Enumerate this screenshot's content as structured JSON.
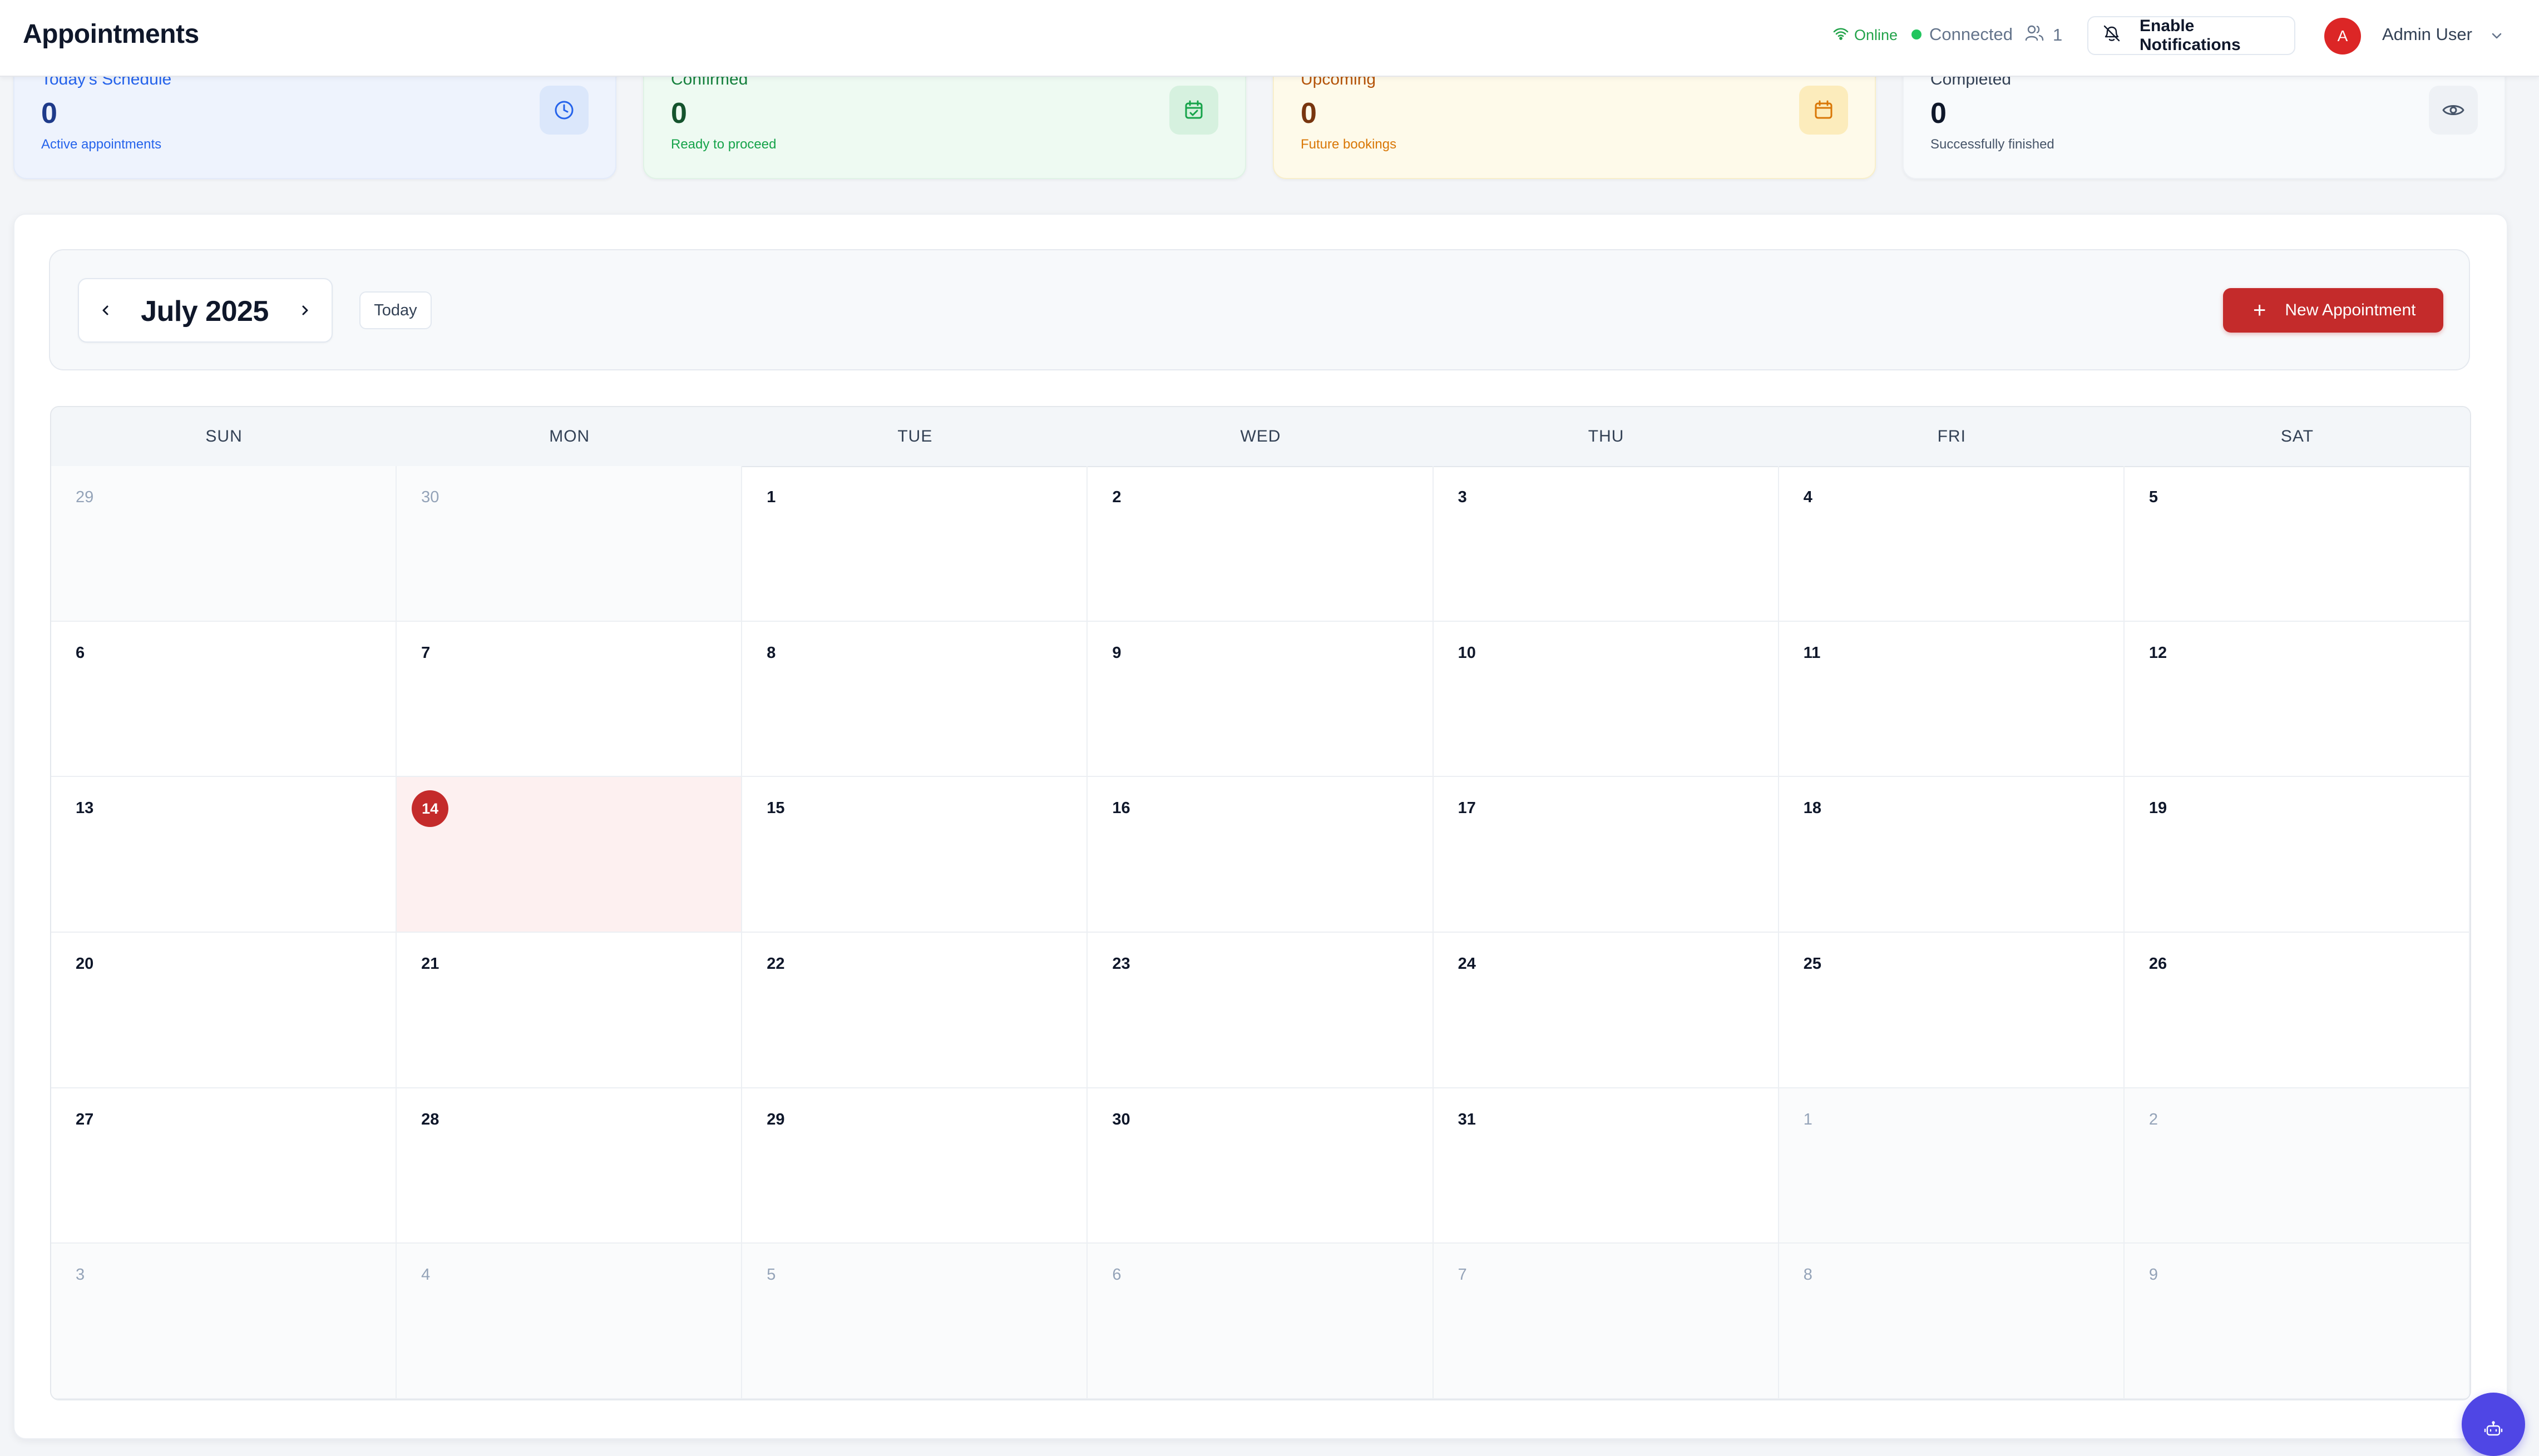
{
  "header": {
    "title": "Appointments",
    "online_label": "Online",
    "connected_label": "Connected",
    "active_users": "1",
    "notifications_button": "Enable Notifications",
    "avatar_initial": "A",
    "user_name": "Admin User"
  },
  "stats": [
    {
      "label": "Today's Schedule",
      "value": "0",
      "sub": "Active appointments",
      "icon": "clock-icon"
    },
    {
      "label": "Confirmed",
      "value": "0",
      "sub": "Ready to proceed",
      "icon": "calendar-check-icon"
    },
    {
      "label": "Upcoming",
      "value": "0",
      "sub": "Future bookings",
      "icon": "calendar-icon"
    },
    {
      "label": "Completed",
      "value": "0",
      "sub": "Successfully finished",
      "icon": "eye-icon"
    }
  ],
  "toolbar": {
    "month_label": "July 2025",
    "today_button": "Today",
    "new_appointment_button": "New Appointment"
  },
  "calendar": {
    "weekdays": [
      "SUN",
      "MON",
      "TUE",
      "WED",
      "THU",
      "FRI",
      "SAT"
    ],
    "today": "14",
    "weeks": [
      [
        {
          "day": "29",
          "outside": true
        },
        {
          "day": "30",
          "outside": true
        },
        {
          "day": "1"
        },
        {
          "day": "2"
        },
        {
          "day": "3"
        },
        {
          "day": "4"
        },
        {
          "day": "5"
        }
      ],
      [
        {
          "day": "6"
        },
        {
          "day": "7"
        },
        {
          "day": "8"
        },
        {
          "day": "9"
        },
        {
          "day": "10"
        },
        {
          "day": "11"
        },
        {
          "day": "12"
        }
      ],
      [
        {
          "day": "13"
        },
        {
          "day": "14",
          "today": true
        },
        {
          "day": "15"
        },
        {
          "day": "16"
        },
        {
          "day": "17"
        },
        {
          "day": "18"
        },
        {
          "day": "19"
        }
      ],
      [
        {
          "day": "20"
        },
        {
          "day": "21"
        },
        {
          "day": "22"
        },
        {
          "day": "23"
        },
        {
          "day": "24"
        },
        {
          "day": "25"
        },
        {
          "day": "26"
        }
      ],
      [
        {
          "day": "27"
        },
        {
          "day": "28"
        },
        {
          "day": "29"
        },
        {
          "day": "30"
        },
        {
          "day": "31"
        },
        {
          "day": "1",
          "outside": true
        },
        {
          "day": "2",
          "outside": true
        }
      ],
      [
        {
          "day": "3",
          "outside": true
        },
        {
          "day": "4",
          "outside": true
        },
        {
          "day": "5",
          "outside": true
        },
        {
          "day": "6",
          "outside": true
        },
        {
          "day": "7",
          "outside": true
        },
        {
          "day": "8",
          "outside": true
        },
        {
          "day": "9",
          "outside": true
        }
      ]
    ]
  },
  "colors": {
    "accent_red": "#c42b2b",
    "online_green": "#22c55e",
    "fab_indigo": "#4f46e5"
  },
  "fab": {
    "icon": "bot-icon"
  }
}
